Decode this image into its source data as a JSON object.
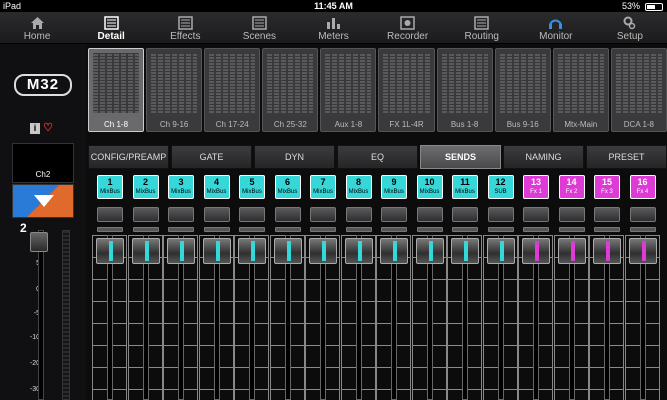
{
  "status": {
    "carrier": "iPad",
    "wifi": "wifi",
    "time": "11:45 AM",
    "battery_pct": "53%"
  },
  "nav": [
    {
      "label": "Home",
      "icon": "home-icon"
    },
    {
      "label": "Detail",
      "icon": "detail-icon",
      "active": true
    },
    {
      "label": "Effects",
      "icon": "effects-icon"
    },
    {
      "label": "Scenes",
      "icon": "scenes-icon"
    },
    {
      "label": "Meters",
      "icon": "meters-icon"
    },
    {
      "label": "Recorder",
      "icon": "recorder-icon"
    },
    {
      "label": "Routing",
      "icon": "routing-icon"
    },
    {
      "label": "Monitor",
      "icon": "headphones-icon"
    },
    {
      "label": "Setup",
      "icon": "gear-icon"
    }
  ],
  "left": {
    "logo": "M32",
    "channel_name": "Ch2",
    "channel_number": "2",
    "scale": [
      "10",
      "5",
      "0",
      "-5",
      "-10",
      "-20",
      "-30"
    ],
    "icon_i": "i"
  },
  "buses": [
    "Ch 1-8",
    "Ch 9-16",
    "Ch 17-24",
    "Ch 25-32",
    "Aux 1-8",
    "FX 1L-4R",
    "Bus 1-8",
    "Bus 9-16",
    "Mtx-Main",
    "DCA 1-8"
  ],
  "tabs": [
    "CONFIG/PREAMP",
    "GATE",
    "DYN",
    "EQ",
    "SENDS",
    "NAMING",
    "PRESET"
  ],
  "active_tab": "SENDS",
  "sends": [
    {
      "num": "1",
      "label": "MixBus",
      "color": "cyan"
    },
    {
      "num": "2",
      "label": "MixBus",
      "color": "cyan"
    },
    {
      "num": "3",
      "label": "MixBus",
      "color": "cyan"
    },
    {
      "num": "4",
      "label": "MixBus",
      "color": "cyan"
    },
    {
      "num": "5",
      "label": "MixBus",
      "color": "cyan"
    },
    {
      "num": "6",
      "label": "MixBus",
      "color": "cyan"
    },
    {
      "num": "7",
      "label": "MixBus",
      "color": "cyan"
    },
    {
      "num": "8",
      "label": "MixBus",
      "color": "cyan"
    },
    {
      "num": "9",
      "label": "MixBus",
      "color": "cyan"
    },
    {
      "num": "10",
      "label": "MixBus",
      "color": "cyan"
    },
    {
      "num": "11",
      "label": "MixBus",
      "color": "cyan"
    },
    {
      "num": "12",
      "label": "SUB",
      "color": "cyan"
    },
    {
      "num": "13",
      "label": "Fx 1",
      "color": "mag"
    },
    {
      "num": "14",
      "label": "Fx 2",
      "color": "mag"
    },
    {
      "num": "15",
      "label": "Fx 3",
      "color": "mag"
    },
    {
      "num": "16",
      "label": "Fx 4",
      "color": "mag"
    }
  ],
  "colors": {
    "cyan": "#36d7d8",
    "magenta": "#de3ad6",
    "channel_blue": "#2a7ad8",
    "channel_orange": "#e06a2b"
  }
}
